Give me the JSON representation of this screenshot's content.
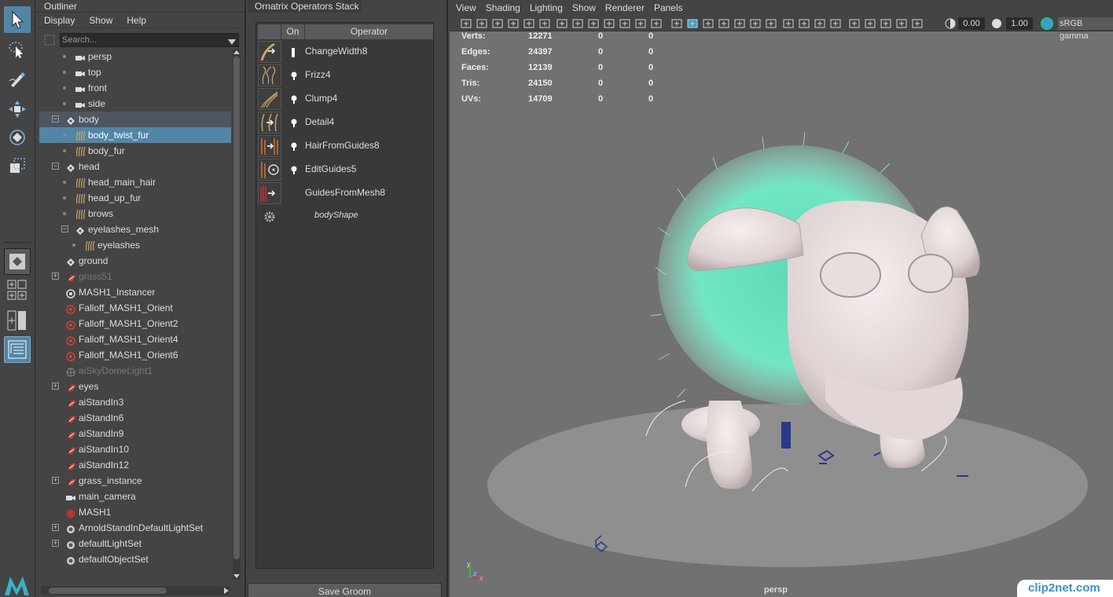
{
  "outliner": {
    "title": "Outliner",
    "menu": [
      "Display",
      "Show",
      "Help"
    ],
    "search_placeholder": "Search...",
    "items": [
      {
        "label": "persp",
        "icon": "camera-icon",
        "indent": 2
      },
      {
        "label": "top",
        "icon": "camera-icon",
        "indent": 2
      },
      {
        "label": "front",
        "icon": "camera-icon",
        "indent": 2
      },
      {
        "label": "side",
        "icon": "camera-icon",
        "indent": 2
      },
      {
        "label": "body",
        "icon": "transform-icon",
        "indent": 1,
        "expander": "−"
      },
      {
        "label": "body_twist_fur",
        "icon": "hair-icon",
        "indent": 2
      },
      {
        "label": "body_fur",
        "icon": "hair-icon",
        "indent": 2
      },
      {
        "label": "head",
        "icon": "transform-icon",
        "indent": 1,
        "expander": "−"
      },
      {
        "label": "head_main_hair",
        "icon": "hair-icon",
        "indent": 2
      },
      {
        "label": "head_up_fur",
        "icon": "hair-icon",
        "indent": 2
      },
      {
        "label": "brows",
        "icon": "hair-icon",
        "indent": 2
      },
      {
        "label": "eyelashes_mesh",
        "icon": "transform-icon",
        "indent": 2,
        "expander": "−"
      },
      {
        "label": "eyelashes",
        "icon": "hair-icon",
        "indent": 3
      },
      {
        "label": "ground",
        "icon": "transform-icon",
        "indent": 1
      },
      {
        "label": "grass51",
        "icon": "standin-icon",
        "indent": 1,
        "expander": "+"
      },
      {
        "label": "MASH1_Instancer",
        "icon": "instancer-icon",
        "indent": 1
      },
      {
        "label": "Falloff_MASH1_Orient",
        "icon": "falloff-icon",
        "indent": 1
      },
      {
        "label": "Falloff_MASH1_Orient2",
        "icon": "falloff-icon",
        "indent": 1
      },
      {
        "label": "Falloff_MASH1_Orient4",
        "icon": "falloff-icon",
        "indent": 1
      },
      {
        "label": "Falloff_MASH1_Orient6",
        "icon": "falloff-icon",
        "indent": 1
      },
      {
        "label": "aiSkyDomeLight1",
        "icon": "skydome-icon",
        "indent": 1
      },
      {
        "label": "eyes",
        "icon": "standin-icon",
        "indent": 1,
        "expander": "+"
      },
      {
        "label": "aiStandIn3",
        "icon": "standin-icon",
        "indent": 1
      },
      {
        "label": "aiStandIn6",
        "icon": "standin-icon",
        "indent": 1
      },
      {
        "label": "aiStandIn9",
        "icon": "standin-icon",
        "indent": 1
      },
      {
        "label": "aiStandIn10",
        "icon": "standin-icon",
        "indent": 1
      },
      {
        "label": "aiStandIn12",
        "icon": "standin-icon",
        "indent": 1
      },
      {
        "label": "grass_instance",
        "icon": "standin-icon",
        "indent": 1,
        "expander": "+"
      },
      {
        "label": "main_camera",
        "icon": "camera-icon",
        "indent": 1
      },
      {
        "label": "MASH1",
        "icon": "mash-icon",
        "indent": 1
      },
      {
        "label": "ArnoldStandInDefaultLightSet",
        "icon": "set-icon",
        "indent": 1,
        "expander": "+"
      },
      {
        "label": "defaultLightSet",
        "icon": "set-icon",
        "indent": 1,
        "expander": "+"
      },
      {
        "label": "defaultObjectSet",
        "icon": "set-icon",
        "indent": 1
      }
    ],
    "selected_index": 5,
    "highlighted_index": 4,
    "dimmed_indices": [
      14,
      20
    ]
  },
  "ornatrix": {
    "title": "Ornatrix Operators Stack",
    "col_on": "On",
    "col_operator": "Operator",
    "operators": [
      "ChangeWidth8",
      "Frizz4",
      "Clump4",
      "Detail4",
      "HairFromGuides8",
      "EditGuides5",
      "GuidesFromMesh8",
      "bodyShape"
    ],
    "save_label": "Save Groom"
  },
  "viewport": {
    "menu": [
      "View",
      "Shading",
      "Lighting",
      "Show",
      "Renderer",
      "Panels"
    ],
    "exposure": "0.00",
    "gamma": "1.00",
    "color_space": "sRGB gamma",
    "hud": [
      {
        "label": "Verts:",
        "v1": "12271",
        "v2": "0",
        "v3": "0"
      },
      {
        "label": "Edges:",
        "v1": "24397",
        "v2": "0",
        "v3": "0"
      },
      {
        "label": "Faces:",
        "v1": "12139",
        "v2": "0",
        "v3": "0"
      },
      {
        "label": "Tris:",
        "v1": "24150",
        "v2": "0",
        "v3": "0"
      },
      {
        "label": "UVs:",
        "v1": "14709",
        "v2": "0",
        "v3": "0"
      }
    ],
    "camera_label": "persp",
    "axis_y": "y",
    "axis_x": "x",
    "axis_z": "z"
  },
  "watermark": "clip2net.com",
  "colors": {
    "selection": "#5285a6",
    "fur": "#6fe0c0",
    "panel": "#444444"
  }
}
